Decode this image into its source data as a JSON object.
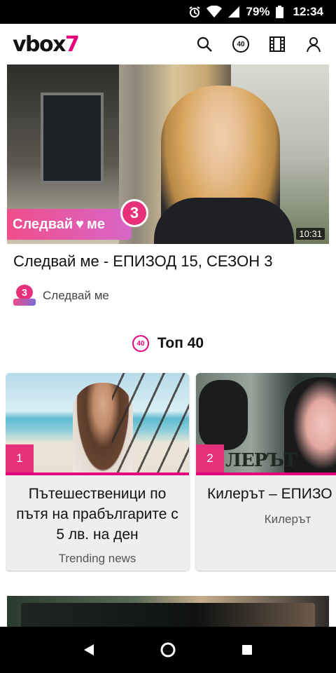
{
  "status_bar": {
    "battery_percent": "79%",
    "time": "12:34",
    "icons": [
      "alarm-icon",
      "wifi-icon",
      "signal-icon",
      "battery-icon"
    ]
  },
  "header": {
    "logo_main": "vbox",
    "logo_accent": "7",
    "top40_badge": "40",
    "icons": [
      "search-icon",
      "top40-icon",
      "film-icon",
      "user-icon"
    ]
  },
  "featured": {
    "series_logo_text": "Следвай",
    "series_logo_text_2": "ме",
    "series_badge": "3",
    "duration": "10:31",
    "title": "Следвай ме - ЕПИЗОД 15, СЕЗОН 3",
    "channel_avatar_badge": "3",
    "channel_name": "Следвай ме"
  },
  "top40": {
    "badge": "40",
    "title": "Топ 40",
    "cards": [
      {
        "rank": "1",
        "title": "Пътешественици по пътя на прабългарите с 5 лв. на ден",
        "channel": "Trending news"
      },
      {
        "rank": "2",
        "thumb_text": "ЛЕРЪТ",
        "title": "Килерът – ЕПИЗО",
        "channel": "Килерът"
      }
    ]
  },
  "colors": {
    "brand": "#e6007e",
    "rank_badge": "#e6317a",
    "card_bg": "#eeeeee"
  },
  "nav_bar": {
    "icons": [
      "back-icon",
      "home-icon",
      "recents-icon"
    ]
  }
}
